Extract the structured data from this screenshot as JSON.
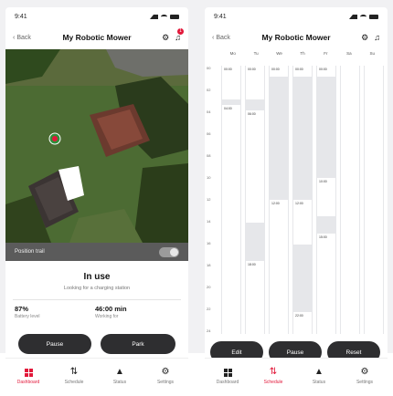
{
  "colors": {
    "accent": "#e2183a",
    "pill": "#2e2e30",
    "grass": "#3d5a2a"
  },
  "left": {
    "status_time": "9:41",
    "nav": {
      "back_label": "Back",
      "title": "My Robotic Mower",
      "badge": "1"
    },
    "map": {
      "toggle_label": "Position trail"
    },
    "status": {
      "title": "In use",
      "subtitle": "Looking for a charging station"
    },
    "metrics": [
      {
        "value": "87%",
        "label": "Battery level"
      },
      {
        "value": "46:00 min",
        "label": "Working for"
      }
    ],
    "buttons": {
      "pause": "Pause",
      "park": "Park"
    },
    "tabs": [
      {
        "label": "Dashboard",
        "icon": "dashboard-icon",
        "active": true
      },
      {
        "label": "Schedule",
        "icon": "schedule-icon",
        "active": false
      },
      {
        "label": "Status",
        "icon": "warning-icon",
        "active": false
      },
      {
        "label": "Settings",
        "icon": "gear-icon",
        "active": false
      }
    ]
  },
  "right": {
    "status_time": "9:41",
    "nav": {
      "back_label": "Back",
      "title": "My Robotic Mower"
    },
    "days": [
      "Mo",
      "Tu",
      "We",
      "Th",
      "Fr",
      "Sa",
      "Su"
    ],
    "hours": [
      "00",
      "02",
      "04",
      "06",
      "08",
      "10",
      "12",
      "14",
      "16",
      "18",
      "20",
      "22",
      "24"
    ],
    "schedule": [
      {
        "day": "Mo",
        "blocks": [
          {
            "start": 0,
            "end": 3,
            "label": "00:00"
          },
          {
            "start": 3.5,
            "end": 24,
            "label": "04:00"
          }
        ]
      },
      {
        "day": "Tu",
        "blocks": [
          {
            "start": 0,
            "end": 3,
            "label": "00:00"
          },
          {
            "start": 4,
            "end": 14,
            "label": "06:00"
          },
          {
            "start": 17.5,
            "end": 24,
            "label": "18:00"
          }
        ]
      },
      {
        "day": "We",
        "blocks": [
          {
            "start": 0,
            "end": 1,
            "label": "00:00"
          },
          {
            "start": 12,
            "end": 24,
            "label": "12:00"
          }
        ]
      },
      {
        "day": "Th",
        "blocks": [
          {
            "start": 0,
            "end": 1,
            "label": "00:00"
          },
          {
            "start": 12,
            "end": 16,
            "label": "12:00"
          },
          {
            "start": 22,
            "end": 24,
            "label": "22:00"
          }
        ]
      },
      {
        "day": "Fr",
        "blocks": [
          {
            "start": 0,
            "end": 1,
            "label": "00:00"
          },
          {
            "start": 10,
            "end": 13.5,
            "label": "10:00"
          },
          {
            "start": 15,
            "end": 24,
            "label": "15:00"
          }
        ]
      },
      {
        "day": "Sa",
        "blocks": [
          {
            "start": 0,
            "end": 24,
            "label": ""
          }
        ]
      },
      {
        "day": "Su",
        "blocks": [
          {
            "start": 0,
            "end": 24,
            "label": ""
          }
        ]
      }
    ],
    "buttons": {
      "edit": "Edit",
      "pause": "Pause",
      "reset": "Reset"
    },
    "tabs": [
      {
        "label": "Dashboard",
        "icon": "dashboard-icon",
        "active": false
      },
      {
        "label": "Schedule",
        "icon": "schedule-icon",
        "active": true
      },
      {
        "label": "Status",
        "icon": "warning-icon",
        "active": false
      },
      {
        "label": "Settings",
        "icon": "gear-icon",
        "active": false
      }
    ]
  }
}
